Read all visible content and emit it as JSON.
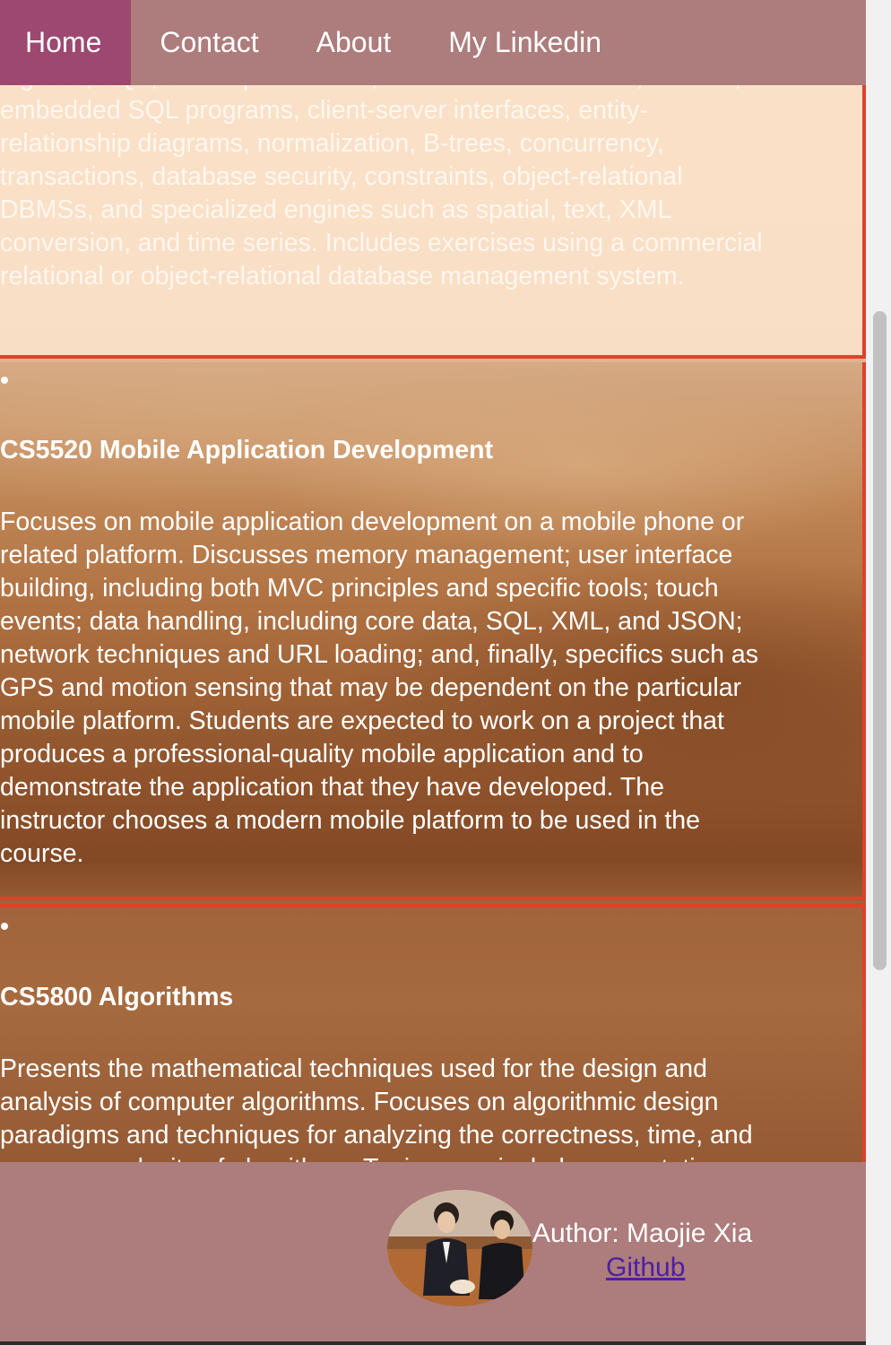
{
  "nav": {
    "items": [
      {
        "label": "Home",
        "active": true
      },
      {
        "label": "Contact",
        "active": false
      },
      {
        "label": "About",
        "active": false
      },
      {
        "label": "My Linkedin",
        "active": false
      }
    ]
  },
  "courses": [
    {
      "title": "",
      "description": "algebra, SQL, stored procedures, user-defined functions, cursors,\nembedded SQL programs, client-server interfaces, entity-\nrelationship diagrams, normalization, B-trees, concurrency,\ntransactions, database security, constraints, object-relational\nDBMSs, and specialized engines such as spatial, text, XML\nconversion, and time series. Includes exercises using a commercial\nrelational or object-relational database management system."
    },
    {
      "title": "CS5520 Mobile Application Development",
      "description": "Focuses on mobile application development on a mobile phone or\nrelated platform. Discusses memory management; user interface\nbuilding, including both MVC principles and specific tools; touch\nevents; data handling, including core data, SQL, XML, and JSON;\nnetwork techniques and URL loading; and, finally, specifics such as\nGPS and motion sensing that may be dependent on the particular\nmobile platform. Students are expected to work on a project that\nproduces a professional-quality mobile application and to\ndemonstrate the application that they have developed. The\ninstructor chooses a modern mobile platform to be used in the\ncourse."
    },
    {
      "title": "CS5800 Algorithms",
      "description": "Presents the mathematical techniques used for the design and\nanalysis of computer algorithms. Focuses on algorithmic design\nparadigms and techniques for analyzing the correctness, time, and\nspace complexity of algorithms. Topics may include asymptotic"
    }
  ],
  "footer": {
    "author": "Author: Maojie Xia",
    "github_label": "Github"
  },
  "colors": {
    "nav_bg": "#ad7c7c",
    "nav_active": "#9c4870",
    "border_accent": "#e0402a",
    "link": "#4c1fa6"
  }
}
